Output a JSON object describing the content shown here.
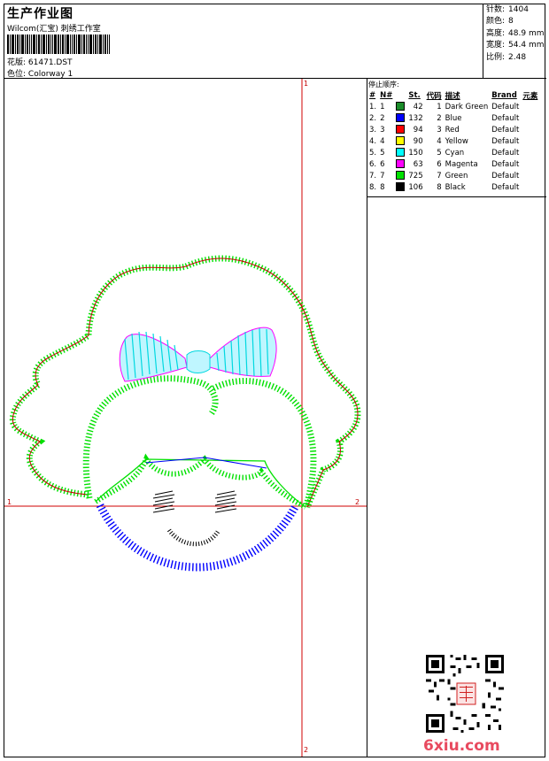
{
  "header": {
    "title": "生产作业图",
    "company": "Wilcom(汇宝) 刺绣工作室",
    "design_label": "花版:",
    "design_value": "61471.DST",
    "colorway_label": "色位:",
    "colorway_value": "Colorway 1"
  },
  "stats": [
    {
      "label": "针数:",
      "value": "1404"
    },
    {
      "label": "颜色:",
      "value": "8"
    },
    {
      "label": "高度:",
      "value": "48.9 mm"
    },
    {
      "label": "宽度:",
      "value": "54.4 mm"
    },
    {
      "label": "比例:",
      "value": "2.48"
    }
  ],
  "legend": {
    "caption": "停止顺序:",
    "headers": [
      "#",
      "N#",
      "St.",
      "代码",
      "描述",
      "Brand",
      "元素"
    ],
    "rows": [
      {
        "idx": "1.",
        "n": "1",
        "color": "#1a8c2a",
        "st": "42",
        "code": "1",
        "desc": "Dark Green",
        "brand": "Default"
      },
      {
        "idx": "2.",
        "n": "2",
        "color": "#0000ff",
        "st": "132",
        "code": "2",
        "desc": "Blue",
        "brand": "Default"
      },
      {
        "idx": "3.",
        "n": "3",
        "color": "#ff0000",
        "st": "94",
        "code": "3",
        "desc": "Red",
        "brand": "Default"
      },
      {
        "idx": "4.",
        "n": "4",
        "color": "#ffff00",
        "st": "90",
        "code": "4",
        "desc": "Yellow",
        "brand": "Default"
      },
      {
        "idx": "5.",
        "n": "5",
        "color": "#00ffff",
        "st": "150",
        "code": "5",
        "desc": "Cyan",
        "brand": "Default"
      },
      {
        "idx": "6.",
        "n": "6",
        "color": "#ff00ff",
        "st": "63",
        "code": "6",
        "desc": "Magenta",
        "brand": "Default"
      },
      {
        "idx": "7.",
        "n": "7",
        "color": "#00e000",
        "st": "725",
        "code": "7",
        "desc": "Green",
        "brand": "Default"
      },
      {
        "idx": "8.",
        "n": "8",
        "color": "#000000",
        "st": "106",
        "code": "8",
        "desc": "Black",
        "brand": "Default"
      }
    ]
  },
  "axes": {
    "v_top": "1",
    "v_bottom": "2",
    "h_left": "1",
    "h_right": "2"
  },
  "watermark": "6xiu.com"
}
